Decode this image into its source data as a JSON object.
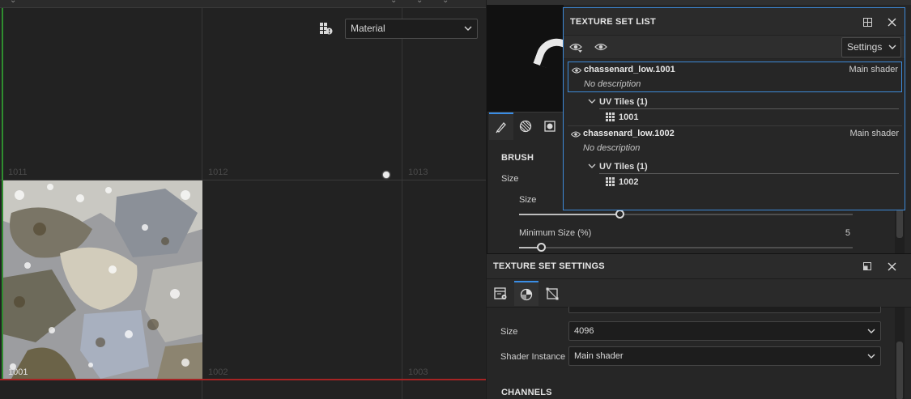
{
  "viewport": {
    "mode_dropdown": "Material",
    "tiles": [
      {
        "id": "tile-1011",
        "label": "1011"
      },
      {
        "id": "tile-1012",
        "label": "1012"
      },
      {
        "id": "tile-1013",
        "label": "1013"
      },
      {
        "id": "tile-1001",
        "label": "1001"
      },
      {
        "id": "tile-1002",
        "label": "1002"
      },
      {
        "id": "tile-1003",
        "label": "1003"
      }
    ]
  },
  "brush": {
    "section_title": "BRUSH",
    "size_label": "Size",
    "size_sub_label": "Size",
    "size_value": 0.3,
    "min_size_label": "Minimum Size (%)",
    "min_size_value": "5"
  },
  "texture_set_list": {
    "title": "TEXTURE SET LIST",
    "settings_dropdown": "Settings",
    "sets": [
      {
        "name": "chassenard_low.1001",
        "shader": "Main shader",
        "description": "No description",
        "uv_group": "UV Tiles (1)",
        "tile": "1001",
        "selected": true
      },
      {
        "name": "chassenard_low.1002",
        "shader": "Main shader",
        "description": "No description",
        "uv_group": "UV Tiles (1)",
        "tile": "1002",
        "selected": false
      }
    ]
  },
  "texture_set_settings": {
    "title": "TEXTURE SET SETTINGS",
    "size_label": "Size",
    "size_value": "4096",
    "shader_label": "Shader Instance",
    "shader_value": "Main shader",
    "channels_title": "CHANNELS"
  },
  "colors": {
    "accent": "#3d8ad8",
    "axis_x": "#a62424",
    "axis_y": "#2f8d2f"
  }
}
